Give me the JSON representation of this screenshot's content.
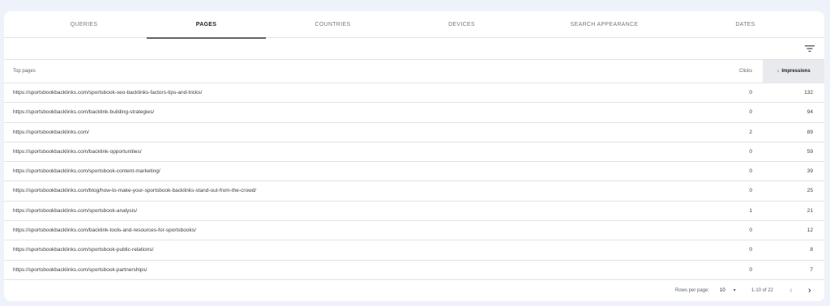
{
  "tabs": [
    {
      "label": "QUERIES"
    },
    {
      "label": "PAGES"
    },
    {
      "label": "COUNTRIES"
    },
    {
      "label": "DEVICES"
    },
    {
      "label": "SEARCH APPEARANCE"
    },
    {
      "label": "DATES"
    }
  ],
  "active_tab": "PAGES",
  "table": {
    "headers": {
      "pages": "Top pages",
      "clicks": "Clicks",
      "impressions": "Impressions"
    },
    "sort": {
      "column": "impressions",
      "direction": "descending",
      "icon": "arrow-down-icon"
    },
    "rows": [
      {
        "page": "https://sportsbookbacklinks.com/sportsbook-seo-backlinks-factors-tips-and-tricks/",
        "clicks": "0",
        "impressions": "132"
      },
      {
        "page": "https://sportsbookbacklinks.com/backlink-building-strategies/",
        "clicks": "0",
        "impressions": "94"
      },
      {
        "page": "https://sportsbookbacklinks.com/",
        "clicks": "2",
        "impressions": "89"
      },
      {
        "page": "https://sportsbookbacklinks.com/backlink-opportunities/",
        "clicks": "0",
        "impressions": "59"
      },
      {
        "page": "https://sportsbookbacklinks.com/sportsbook-content-marketing/",
        "clicks": "0",
        "impressions": "39"
      },
      {
        "page": "https://sportsbookbacklinks.com/blog/how-to-make-your-sportsbook-backlinks-stand-out-from-the-crowd/",
        "clicks": "0",
        "impressions": "25"
      },
      {
        "page": "https://sportsbookbacklinks.com/sportsbook-analysis/",
        "clicks": "1",
        "impressions": "21"
      },
      {
        "page": "https://sportsbookbacklinks.com/backlink-tools-and-resources-for-sportsbooks/",
        "clicks": "0",
        "impressions": "12"
      },
      {
        "page": "https://sportsbookbacklinks.com/sportsbook-public-relations/",
        "clicks": "0",
        "impressions": "8"
      },
      {
        "page": "https://sportsbookbacklinks.com/sportsbook-partnerships/",
        "clicks": "0",
        "impressions": "7"
      }
    ]
  },
  "footer": {
    "rows_per_page_label": "Rows per page:",
    "rows_per_page_value": "10",
    "range": "1-10 of 22"
  },
  "icons": {
    "filter": "filter-icon",
    "prev": "chevron-left-icon",
    "next": "chevron-right-icon"
  },
  "colors": {
    "background": "#eef3fb",
    "card": "#ffffff",
    "active_underline": "#5f6368",
    "sorted_header_bg": "#e8eaed"
  }
}
